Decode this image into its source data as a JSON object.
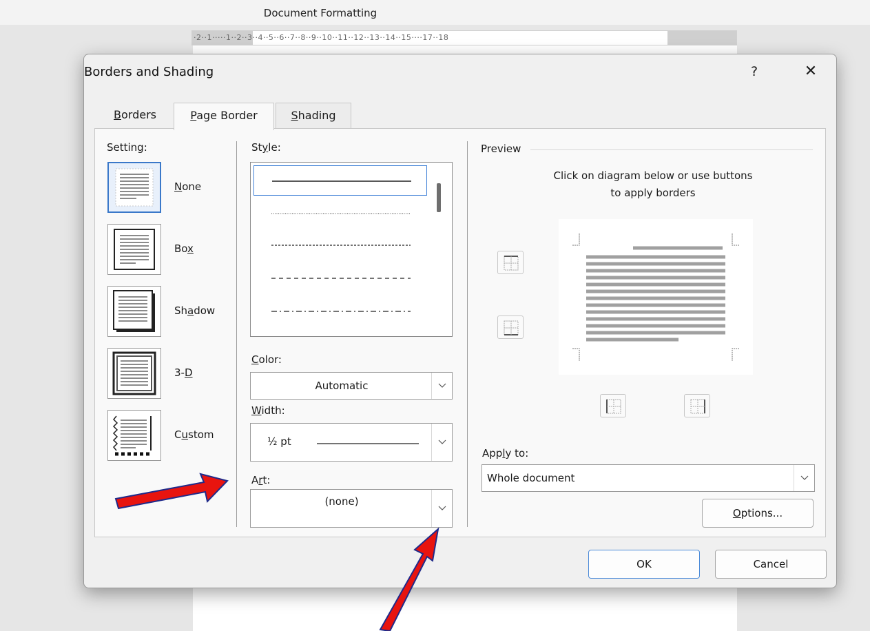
{
  "app": {
    "document_title": "Document Formatting",
    "ruler_text": "·2··1·····1··2··3··4··5··6··7··8··9··10··11··12··13··14··15····17··18"
  },
  "dialog": {
    "title": "Borders and Shading",
    "help_label": "?",
    "close_label": "✕",
    "tabs": [
      {
        "label_pre": "",
        "label_ul": "B",
        "label_post": "orders",
        "selected": false
      },
      {
        "label_pre": "",
        "label_ul": "P",
        "label_post": "age Border",
        "selected": true
      },
      {
        "label_pre": "",
        "label_ul": "S",
        "label_post": "hading",
        "selected": false
      }
    ],
    "setting": {
      "label": "Setting:",
      "options": [
        {
          "pre": "",
          "ul": "N",
          "post": "one",
          "icon": "setting-none-icon",
          "selected": true
        },
        {
          "pre": "Bo",
          "ul": "x",
          "post": "",
          "icon": "setting-box-icon",
          "selected": false
        },
        {
          "pre": "Sh",
          "ul": "a",
          "post": "dow",
          "icon": "setting-shadow-icon",
          "selected": false
        },
        {
          "pre": "3-",
          "ul": "D",
          "post": "",
          "icon": "setting-3d-icon",
          "selected": false
        },
        {
          "pre": "C",
          "ul": "u",
          "post": "stom",
          "icon": "setting-custom-icon",
          "selected": false
        }
      ]
    },
    "style": {
      "label_pre": "St",
      "label_ul": "y",
      "label_post": "le:",
      "options": [
        "solid",
        "dotted",
        "fine-dashed",
        "dashed",
        "dash-dot"
      ],
      "selected_index": 0
    },
    "color": {
      "label_pre": "",
      "label_ul": "C",
      "label_post": "olor:",
      "value": "Automatic"
    },
    "width": {
      "label_pre": "",
      "label_ul": "W",
      "label_post": "idth:",
      "value": "½ pt"
    },
    "art": {
      "label_pre": "A",
      "label_ul": "r",
      "label_post": "t:",
      "value": "(none)"
    },
    "preview": {
      "label": "Preview",
      "instruction_line1": "Click on diagram below or use buttons",
      "instruction_line2": "to apply borders",
      "buttons": [
        "top-border-icon",
        "bottom-border-icon",
        "left-border-icon",
        "right-border-icon"
      ]
    },
    "apply_to": {
      "label_pre": "App",
      "label_ul": "l",
      "label_post": "y to:",
      "value": "Whole document"
    },
    "options_button": {
      "label_pre": "",
      "label_ul": "O",
      "label_post": "ptions..."
    },
    "ok_label": "OK",
    "cancel_label": "Cancel"
  },
  "annotations": {
    "arrow_color": "#e8140f",
    "arrow_outline": "#1f2a8a"
  },
  "colors": {
    "accent": "#3a78c9",
    "dialog_bg": "#f0f0f0",
    "panel_bg": "#f9f9f9"
  }
}
